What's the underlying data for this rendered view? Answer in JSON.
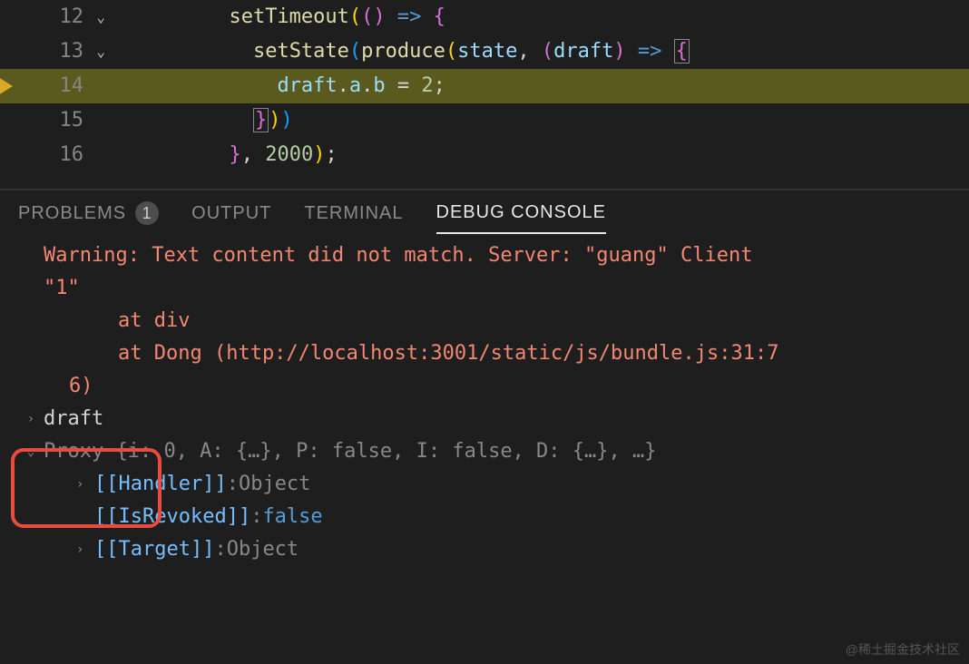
{
  "editor": {
    "lines": [
      {
        "num": "12",
        "fold": true,
        "bp": false,
        "hl": false,
        "tokens": [
          {
            "cls": "tok-fn",
            "t": "setTimeout"
          },
          {
            "cls": "tok-paren-yellow",
            "t": "("
          },
          {
            "cls": "tok-paren-purple",
            "t": "("
          },
          {
            "cls": "tok-paren-purple",
            "t": ")"
          },
          {
            "cls": "tok-white",
            "t": " "
          },
          {
            "cls": "tok-arrow",
            "t": "=>"
          },
          {
            "cls": "tok-white",
            "t": " "
          },
          {
            "cls": "tok-paren-purple",
            "t": "{"
          }
        ],
        "indent": "          "
      },
      {
        "num": "13",
        "fold": true,
        "bp": false,
        "hl": false,
        "tokens": [
          {
            "cls": "tok-fn",
            "t": "setState"
          },
          {
            "cls": "tok-paren-blue",
            "t": "("
          },
          {
            "cls": "tok-fn",
            "t": "produce"
          },
          {
            "cls": "tok-paren-yellow",
            "t": "("
          },
          {
            "cls": "tok-var",
            "t": "state"
          },
          {
            "cls": "tok-punct",
            "t": ", "
          },
          {
            "cls": "tok-paren-purple",
            "t": "("
          },
          {
            "cls": "tok-var",
            "t": "draft"
          },
          {
            "cls": "tok-paren-purple",
            "t": ")"
          },
          {
            "cls": "tok-white",
            "t": " "
          },
          {
            "cls": "tok-arrow",
            "t": "=>"
          },
          {
            "cls": "tok-white",
            "t": " "
          },
          {
            "cls": "tok-paren-purple brace-box",
            "t": "{"
          }
        ],
        "indent": "            "
      },
      {
        "num": "14",
        "fold": false,
        "bp": true,
        "hl": true,
        "tokens": [
          {
            "cls": "tok-var",
            "t": "draft"
          },
          {
            "cls": "tok-punct",
            "t": "."
          },
          {
            "cls": "tok-prop",
            "t": "a"
          },
          {
            "cls": "tok-punct",
            "t": "."
          },
          {
            "cls": "tok-prop",
            "t": "b"
          },
          {
            "cls": "tok-white",
            "t": " = "
          },
          {
            "cls": "tok-num",
            "t": "2"
          },
          {
            "cls": "tok-punct",
            "t": ";"
          }
        ],
        "indent": "              "
      },
      {
        "num": "15",
        "fold": false,
        "bp": false,
        "hl": false,
        "tokens": [
          {
            "cls": "tok-paren-purple brace-box",
            "t": "}"
          },
          {
            "cls": "tok-paren-yellow",
            "t": ")"
          },
          {
            "cls": "tok-paren-blue",
            "t": ")"
          }
        ],
        "indent": "            "
      },
      {
        "num": "16",
        "fold": false,
        "bp": false,
        "hl": false,
        "tokens": [
          {
            "cls": "tok-paren-purple",
            "t": "}"
          },
          {
            "cls": "tok-punct",
            "t": ", "
          },
          {
            "cls": "tok-num",
            "t": "2000"
          },
          {
            "cls": "tok-paren-yellow",
            "t": ")"
          },
          {
            "cls": "tok-punct",
            "t": ";"
          }
        ],
        "indent": "          "
      }
    ]
  },
  "tabs": {
    "problems": "PROBLEMS",
    "problems_badge": "1",
    "output": "OUTPUT",
    "terminal": "TERMINAL",
    "debug_console": "DEBUG CONSOLE"
  },
  "console": {
    "warning_line1": "Warning: Text content did not match. Server: \"guang\" Client",
    "warning_line2": "\"1\"",
    "at_div": "at div",
    "at_dong": "at Dong (http://localhost:3001/static/js/bundle.js:31:7",
    "at_dong_end": "6)",
    "input": "draft",
    "proxy_line": "Proxy {i: 0, A: {…}, P: false, I: false, D: {…}, …}",
    "handler_key": "[[Handler]]",
    "handler_val": "Object",
    "isrevoked_key": "[[IsRevoked]]",
    "isrevoked_val": "false",
    "target_key": "[[Target]]",
    "target_val": "Object"
  },
  "watermark": "@稀土掘金技术社区"
}
